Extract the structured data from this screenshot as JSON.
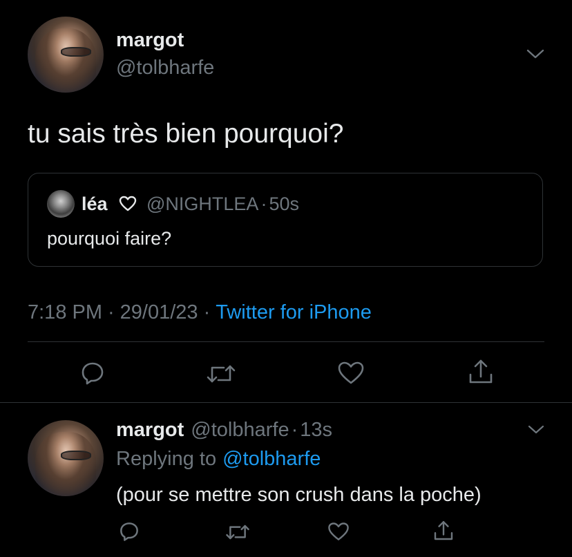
{
  "main_tweet": {
    "author_name": "margot",
    "author_handle": "@tolbharfe",
    "text": "tu sais très bien pourquoi?",
    "quote": {
      "author_name": "léa",
      "author_handle": "@NIGHTLEA",
      "separator": "·",
      "time_ago": "50s",
      "text": "pourquoi faire?"
    },
    "meta": {
      "time": "7:18 PM",
      "sep1": "·",
      "date": "29/01/23",
      "sep2": "·",
      "source": "Twitter for iPhone"
    }
  },
  "reply_tweet": {
    "author_name": "margot",
    "author_handle": "@tolbharfe",
    "separator": "·",
    "time_ago": "13s",
    "replying_prefix": "Replying to",
    "replying_to": "@tolbharfe",
    "text": "(pour se mettre son crush dans la poche)"
  },
  "colors": {
    "background": "#000000",
    "text": "#e7e9ea",
    "muted": "#6e767d",
    "accent": "#1d9bf0",
    "divider": "#2f3336"
  },
  "icons": [
    "chevron-down-icon",
    "heart-outline-icon",
    "reply-icon",
    "retweet-icon",
    "like-icon",
    "share-icon"
  ]
}
